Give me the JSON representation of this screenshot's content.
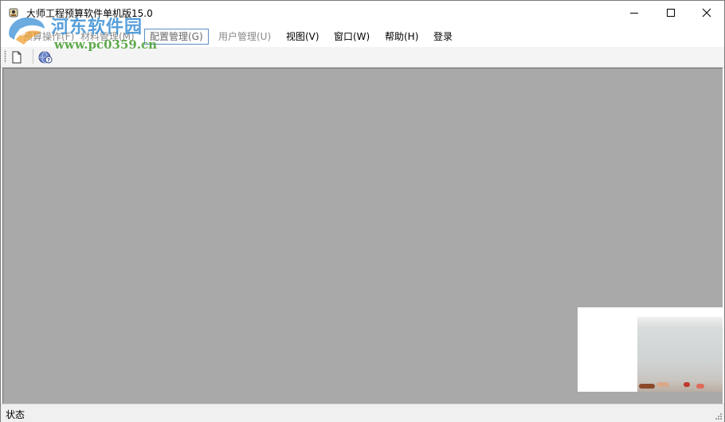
{
  "window": {
    "title": "大师工程预算软件单机版15.0"
  },
  "title_buttons": {
    "minimize": "minimize-icon",
    "maximize": "maximize-icon",
    "close": "close-icon"
  },
  "menu": [
    {
      "label": "预算操作(F)"
    },
    {
      "label": "材料管理(M)"
    },
    {
      "label": "配置管理(G)"
    },
    {
      "label": "用户管理(U)"
    },
    {
      "label": "视图(V)"
    },
    {
      "label": "窗口(W)"
    },
    {
      "label": "帮助(H)"
    },
    {
      "label": "登录"
    }
  ],
  "toolbar": {
    "new_icon": "new-document-icon",
    "help_icon": "help-globe-icon"
  },
  "status": {
    "text": "状态"
  },
  "watermark": {
    "site": "河东软件园",
    "url": "www.pc0359.cn"
  },
  "colors": {
    "workspace": "#a9a9a9",
    "menu_highlight": "#5b8fc8",
    "disabled_text": "#8a8a8a"
  }
}
